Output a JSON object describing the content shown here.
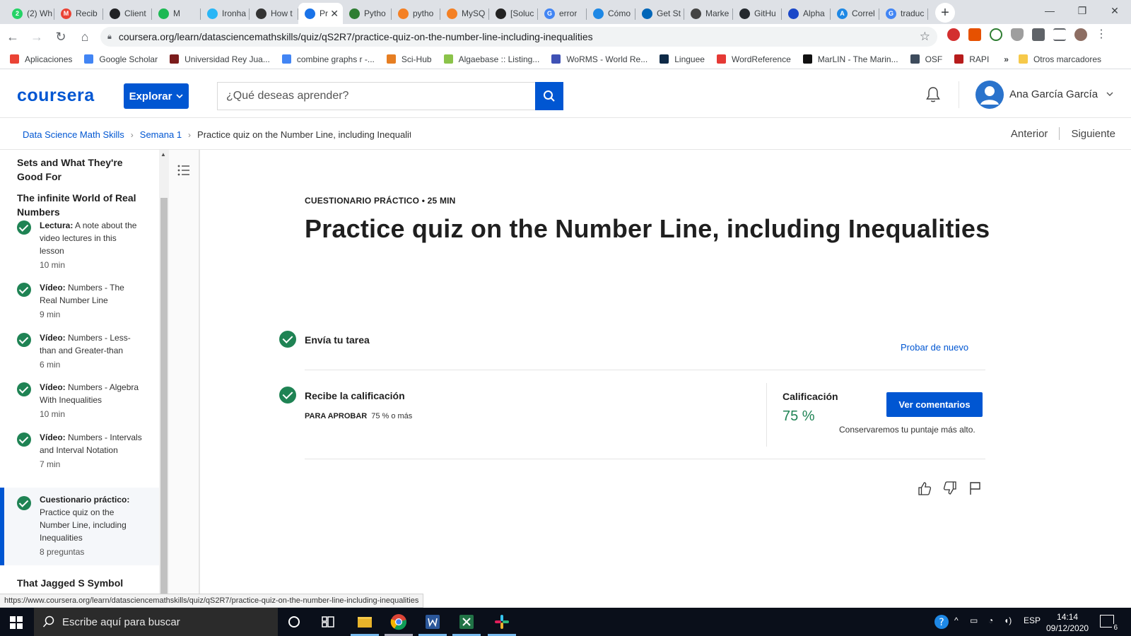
{
  "browser": {
    "tabs": [
      {
        "label": "(2) Wh",
        "color": "#25d366",
        "glyph": "2"
      },
      {
        "label": "Recib",
        "color": "#ea4335",
        "glyph": "M"
      },
      {
        "label": "Client",
        "color": "#202124",
        "glyph": ""
      },
      {
        "label": "M",
        "color": "#1db954",
        "glyph": ""
      },
      {
        "label": "Ironha",
        "color": "#29b6f6",
        "glyph": ""
      },
      {
        "label": "How t",
        "color": "#333333",
        "glyph": ""
      },
      {
        "label": "Pr",
        "color": "#1a73e8",
        "glyph": "",
        "active": true
      },
      {
        "label": "Pytho",
        "color": "#2e7d32",
        "glyph": ""
      },
      {
        "label": "pytho",
        "color": "#f48024",
        "glyph": ""
      },
      {
        "label": "MySQ",
        "color": "#f48024",
        "glyph": ""
      },
      {
        "label": "[Soluc",
        "color": "#222222",
        "glyph": ""
      },
      {
        "label": "error",
        "color": "#4285f4",
        "glyph": "G"
      },
      {
        "label": "Cómo",
        "color": "#1e88e5",
        "glyph": ""
      },
      {
        "label": "Get St",
        "color": "#0066b8",
        "glyph": ""
      },
      {
        "label": "Marke",
        "color": "#444444",
        "glyph": ""
      },
      {
        "label": "GitHu",
        "color": "#24292e",
        "glyph": ""
      },
      {
        "label": "Alpha",
        "color": "#1a47c8",
        "glyph": ""
      },
      {
        "label": "Correl",
        "color": "#1e88e5",
        "glyph": "A"
      },
      {
        "label": "traduc",
        "color": "#4285f4",
        "glyph": "G"
      }
    ],
    "url": "coursera.org/learn/datasciencemathskills/quiz/qS2R7/practice-quiz-on-the-number-line-including-inequalities",
    "bookmarks": [
      {
        "label": "Aplicaciones",
        "color": "#ea4335"
      },
      {
        "label": "Google Scholar",
        "color": "#4285f4"
      },
      {
        "label": "Universidad Rey Jua...",
        "color": "#7b1c1c"
      },
      {
        "label": "combine graphs r -...",
        "color": "#4285f4"
      },
      {
        "label": "Sci-Hub",
        "color": "#e67e22"
      },
      {
        "label": "Algaebase :: Listing...",
        "color": "#8bc34a"
      },
      {
        "label": "WoRMS - World Re...",
        "color": "#3f51b5"
      },
      {
        "label": "Linguee",
        "color": "#0e2a47"
      },
      {
        "label": "WordReference",
        "color": "#e53935"
      },
      {
        "label": "MarLIN - The Marin...",
        "color": "#111111"
      },
      {
        "label": "OSF",
        "color": "#3d4b5c"
      },
      {
        "label": "RAPI",
        "color": "#b71c1c"
      }
    ],
    "bookmarks_more": "»",
    "other_bookmarks": "Otros marcadores",
    "status_url": "https://www.coursera.org/learn/datasciencemathskills/quiz/qS2R7/practice-quiz-on-the-number-line-including-inequalities"
  },
  "header": {
    "logo": "coursera",
    "explore_label": "Explorar",
    "search_placeholder": "¿Qué deseas aprender?",
    "username": "Ana García García"
  },
  "breadcrumb": {
    "items": [
      "Data Science Math Skills",
      "Semana 1"
    ],
    "current": "Practice quiz on the Number Line, including Inequalities",
    "prev": "Anterior",
    "next": "Siguiente"
  },
  "sidebar": {
    "section_top": "Sets and What They're Good For",
    "section_current": "The infinite World of Real Numbers",
    "section_next": "That Jagged S Symbol",
    "items": [
      {
        "type": "Lectura:",
        "title": "A note about the video lectures in this lesson",
        "duration": "10 min"
      },
      {
        "type": "Vídeo:",
        "title": "Numbers - The Real Number Line",
        "duration": "9 min"
      },
      {
        "type": "Vídeo:",
        "title": "Numbers - Less-than and Greater-than",
        "duration": "6 min"
      },
      {
        "type": "Vídeo:",
        "title": "Numbers - Algebra With Inequalities",
        "duration": "10 min"
      },
      {
        "type": "Vídeo:",
        "title": "Numbers - Intervals and Interval Notation",
        "duration": "7 min"
      },
      {
        "type": "Cuestionario práctico:",
        "title": "Practice quiz on the Number Line, including Inequalities",
        "duration": "8 preguntas"
      }
    ]
  },
  "main": {
    "eyebrow": "CUESTIONARIO PRÁCTICO • 25 MIN",
    "title": "Practice quiz on the Number Line, including Inequalities",
    "submit_step": "Envía tu tarea",
    "retry_link": "Probar de nuevo",
    "grade_step": "Recibe la calificación",
    "pass_label": "PARA APROBAR",
    "pass_value": "75 % o más",
    "grade_label": "Calificación",
    "grade_value": "75 %",
    "feedback_button": "Ver comentarios",
    "keep_note": "Conservaremos tu puntaje más alto."
  },
  "taskbar": {
    "search_text": "Escribe aquí para buscar",
    "lang": "ESP",
    "time": "14:14",
    "date": "09/12/2020",
    "notifications": "6"
  }
}
